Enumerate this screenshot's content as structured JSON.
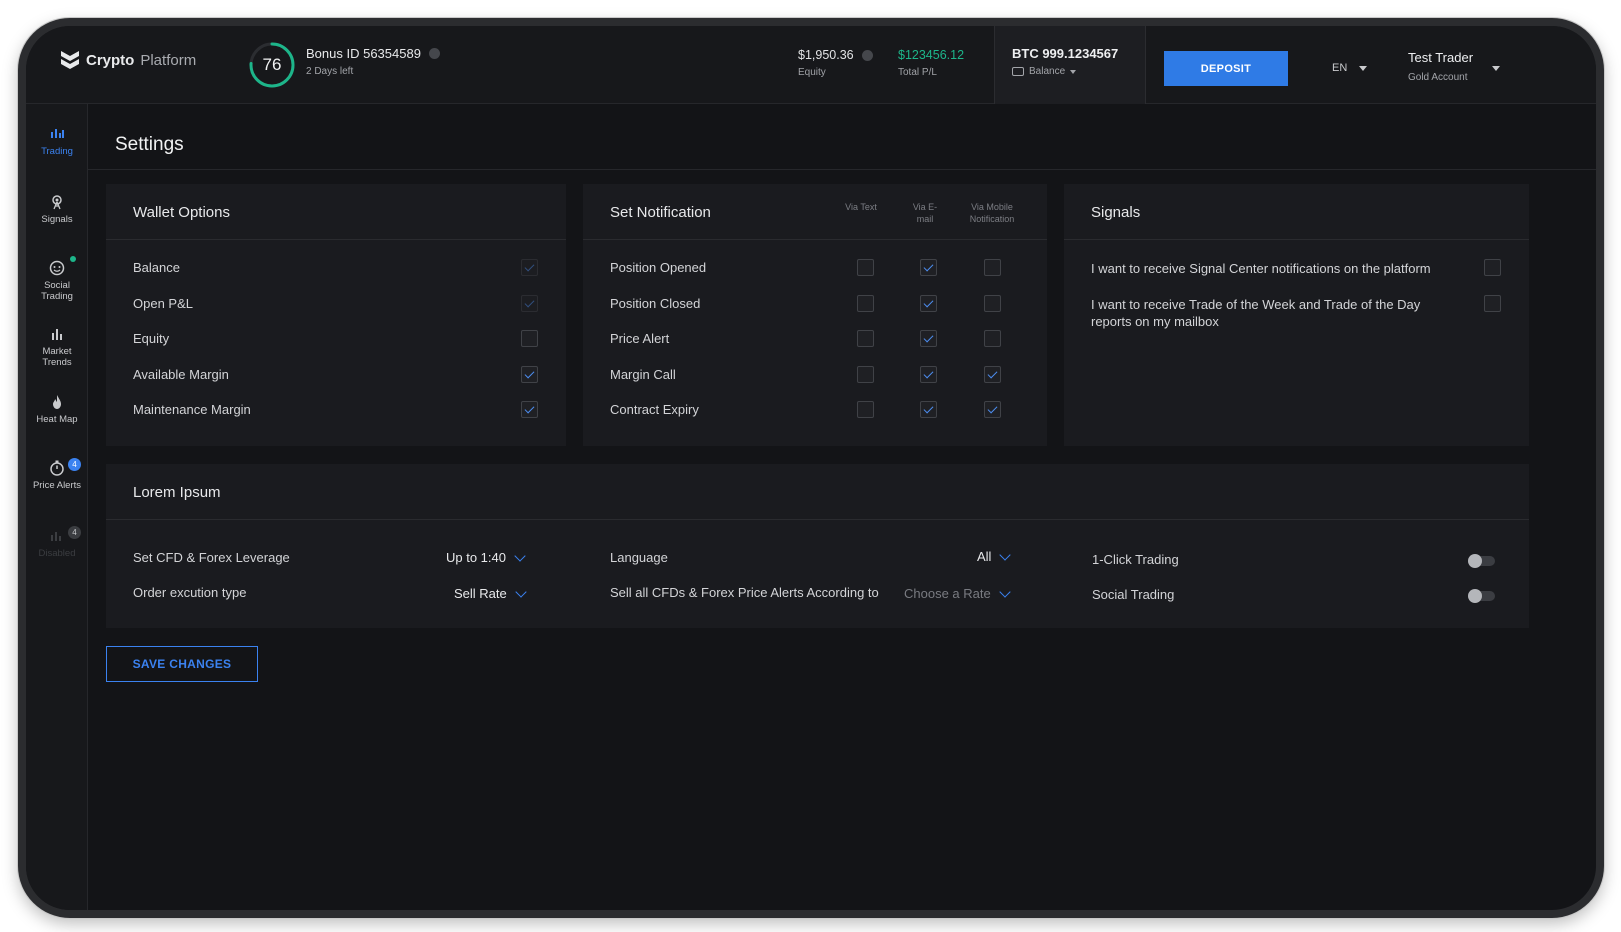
{
  "header": {
    "logo_bold": "Crypto",
    "logo_light": "Platform",
    "bonus_score": "76",
    "bonus_progress": 0.76,
    "bonus_title": "Bonus ID 56354589",
    "bonus_sub": "2 Days left",
    "equity_value": "$1,950.36",
    "equity_label": "Equity",
    "pl_value": "$123456.12",
    "pl_label": "Total P/L",
    "btc_value": "BTC 999.1234567",
    "btc_label": "Balance",
    "deposit_label": "DEPOSIT",
    "language": "EN",
    "user_name": "Test Trader",
    "user_account": "Gold Account"
  },
  "sidebar": {
    "items": [
      {
        "label": "Trading",
        "icon": "bar-chart-icon",
        "state": "active"
      },
      {
        "label": "Signals",
        "icon": "signal-tower-icon",
        "state": "normal"
      },
      {
        "label": "Social Trading",
        "icon": "social-face-icon",
        "state": "normal",
        "indicator": "online-dot"
      },
      {
        "label": "Market Trends",
        "icon": "trends-icon",
        "state": "normal"
      },
      {
        "label": "Heat Map",
        "icon": "flame-icon",
        "state": "normal"
      },
      {
        "label": "Price Alerts",
        "icon": "stopwatch-icon",
        "state": "normal",
        "badge": "4"
      },
      {
        "label": "Disabled",
        "icon": "bar-chart-icon",
        "state": "disabled",
        "badge": "4"
      }
    ]
  },
  "page_title": "Settings",
  "wallet": {
    "title": "Wallet Options",
    "rows": [
      {
        "label": "Balance",
        "checked": true,
        "faded": true
      },
      {
        "label": "Open P&L",
        "checked": true,
        "faded": true
      },
      {
        "label": "Equity",
        "checked": false,
        "faded": false
      },
      {
        "label": "Available Margin",
        "checked": true,
        "faded": false
      },
      {
        "label": "Maintenance Margin",
        "checked": true,
        "faded": false
      }
    ]
  },
  "notification": {
    "title": "Set Notification",
    "col_text": "Via Text",
    "col_email": "Via E-mail",
    "col_mobile": "Via Mobile Notification",
    "rows": [
      {
        "label": "Position Opened",
        "text": false,
        "email": true,
        "mobile": false
      },
      {
        "label": "Position Closed",
        "text": false,
        "email": true,
        "mobile": false
      },
      {
        "label": "Price Alert",
        "text": false,
        "email": true,
        "mobile": false
      },
      {
        "label": "Margin Call",
        "text": false,
        "email": true,
        "mobile": true
      },
      {
        "label": "Contract Expiry",
        "text": false,
        "email": true,
        "mobile": true
      }
    ]
  },
  "signals": {
    "title": "Signals",
    "rows": [
      {
        "label": "I want to receive Signal Center notifications on the platform",
        "checked": false
      },
      {
        "label": "I want to receive Trade of the Week and Trade of the Day reports on my mailbox",
        "checked": false
      }
    ]
  },
  "lorem": {
    "title": "Lorem Ipsum",
    "leverage_label": "Set CFD & Forex Leverage",
    "leverage_value": "Up to 1:40",
    "order_label": "Order excution type",
    "order_value": "Sell Rate",
    "language_label": "Language",
    "language_value": "All",
    "alerts_label": "Sell all CFDs & Forex Price Alerts According to",
    "alerts_placeholder": "Choose a Rate",
    "one_click_label": "1-Click Trading",
    "one_click_on": false,
    "social_label": "Social Trading",
    "social_on": false
  },
  "save_label": "SAVE CHANGES",
  "colors": {
    "accent": "#3b82f0",
    "positive": "#1db58a",
    "background": "#131417",
    "panel": "#1a1b1f"
  }
}
